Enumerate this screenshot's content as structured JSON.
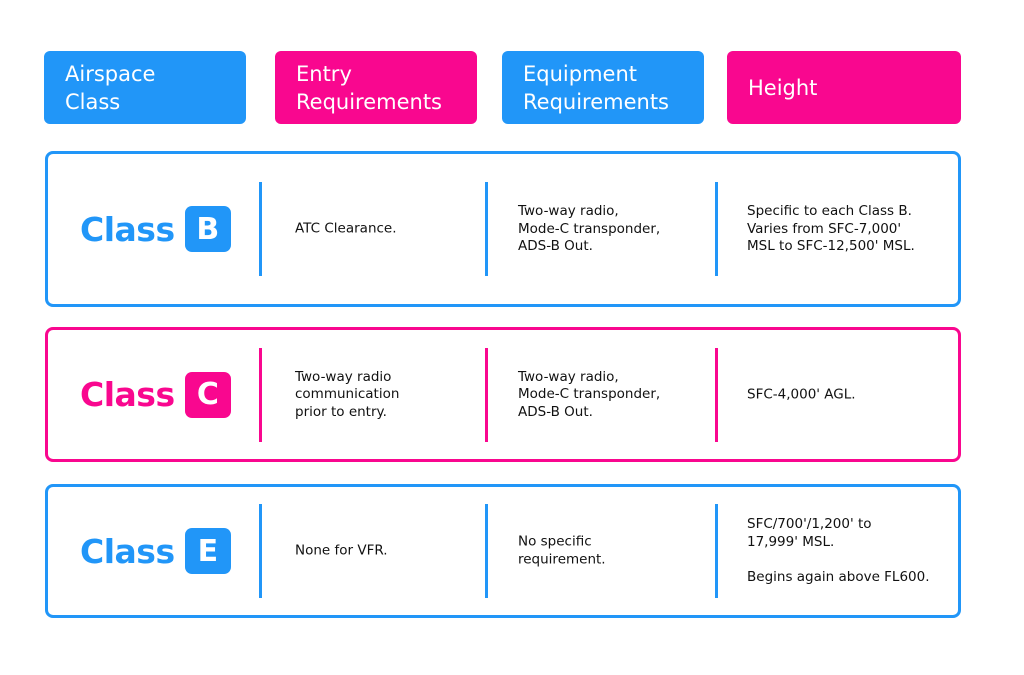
{
  "colors": {
    "blue": "#2196f8",
    "pink": "#f9078f"
  },
  "headers": [
    {
      "label": "Airspace\nClass",
      "color": "blue"
    },
    {
      "label": "Entry\nRequirements",
      "color": "pink"
    },
    {
      "label": "Equipment\nRequirements",
      "color": "blue"
    },
    {
      "label": "Height",
      "color": "pink"
    }
  ],
  "rows": [
    {
      "class_word": "Class",
      "class_letter": "B",
      "color": "blue",
      "entry": "ATC Clearance.",
      "equipment": "Two-way radio,\nMode-C transponder,\nADS-B Out.",
      "height": "Specific to each Class B.\nVaries from SFC-7,000'\nMSL to SFC-12,500' MSL."
    },
    {
      "class_word": "Class",
      "class_letter": "C",
      "color": "pink",
      "entry": "Two-way radio\ncommunication\nprior to entry.",
      "equipment": "Two-way radio,\nMode-C transponder,\nADS-B Out.",
      "height": "SFC-4,000' AGL."
    },
    {
      "class_word": "Class",
      "class_letter": "E",
      "color": "blue",
      "entry": "None for VFR.",
      "equipment": "No specific\nrequirement.",
      "height": "SFC/700'/1,200' to\n17,999' MSL.\n\nBegins again above FL600."
    }
  ]
}
